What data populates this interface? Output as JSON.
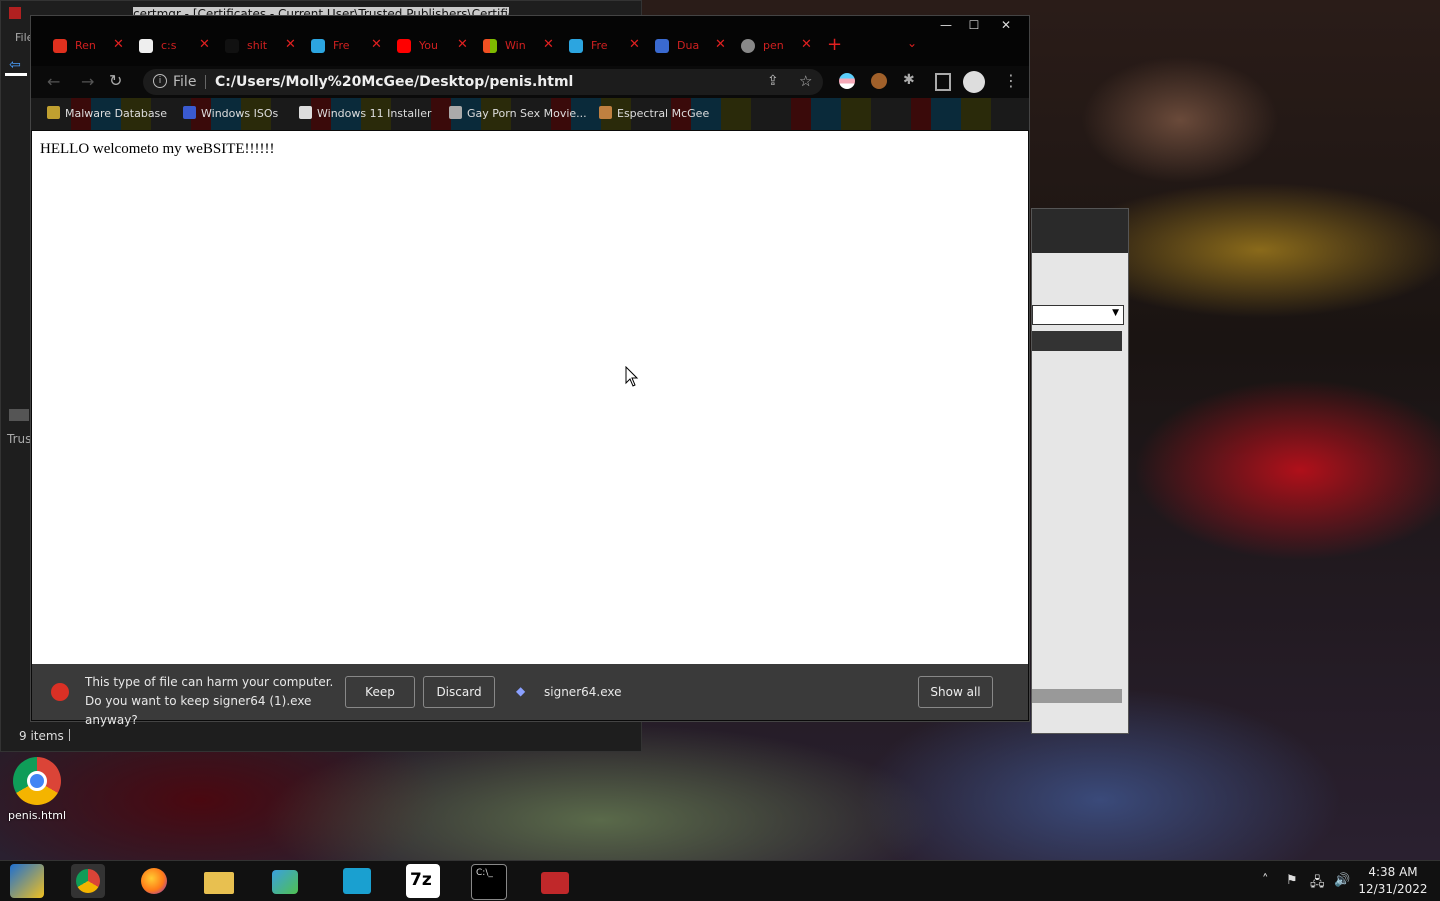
{
  "desktop": {
    "icon_label": "penis.html"
  },
  "certmgr": {
    "title": "certmgr - [Certificates - Current User\\Trusted Publishers\\Certificates]",
    "menu_file": "File",
    "tree_trust": "Trus",
    "status_items": "9 items"
  },
  "browser": {
    "tabs": [
      {
        "title": "Ren",
        "icon_color": "#e0301e"
      },
      {
        "title": "c:s",
        "icon_color": "#eeeeee"
      },
      {
        "title": "shit",
        "icon_color": "#111111"
      },
      {
        "title": "Fre",
        "icon_color": "#2ca5e0"
      },
      {
        "title": "You",
        "icon_color": "#ff0000"
      },
      {
        "title": "Win",
        "icon_color": "#f25022"
      },
      {
        "title": "Fre",
        "icon_color": "#2ca5e0"
      },
      {
        "title": "Dua",
        "icon_color": "#3a6ad0"
      },
      {
        "title": "pen",
        "icon_color": "#888888"
      }
    ],
    "new_tab": "+",
    "url_scheme": "File",
    "url": "C:/Users/Molly%20McGee/Desktop/penis.html",
    "bookmarks": [
      {
        "label": "Malware Database",
        "icon_color": "#c0a030"
      },
      {
        "label": "Windows ISOs",
        "icon_color": "#3a5ad0"
      },
      {
        "label": "Windows 11 Installer",
        "icon_color": "#dddddd"
      },
      {
        "label": "Gay Porn Sex Movie...",
        "icon_color": "#aaaaaa"
      },
      {
        "label": "Espectral McGee",
        "icon_color": "#c08040"
      }
    ],
    "page_text": "HELLO welcometo my weBSITE!!!!!!",
    "download": {
      "warning": "This type of file can harm your computer. Do you want to keep signer64 (1).exe anyway?",
      "keep": "Keep",
      "discard": "Discard",
      "filename": "signer64.exe",
      "show_all": "Show all"
    }
  },
  "taskbar": {
    "apps": [
      {
        "name": "store-icon",
        "color": "#1e6fd0"
      },
      {
        "name": "chrome-icon",
        "color": "#db4437"
      },
      {
        "name": "firefox-icon",
        "color": "#ff7a18"
      },
      {
        "name": "file-explorer-icon",
        "color": "#e8c050"
      },
      {
        "name": "network-users-icon",
        "color": "#3aa0e0"
      },
      {
        "name": "remote-app-icon",
        "color": "#1aa0d0"
      },
      {
        "name": "7zip-icon",
        "color": "#ffffff"
      },
      {
        "name": "cmd-icon",
        "color": "#000000"
      },
      {
        "name": "toolbox-icon",
        "color": "#c0282a"
      }
    ],
    "time": "4:38 AM",
    "date": "12/31/2022"
  }
}
